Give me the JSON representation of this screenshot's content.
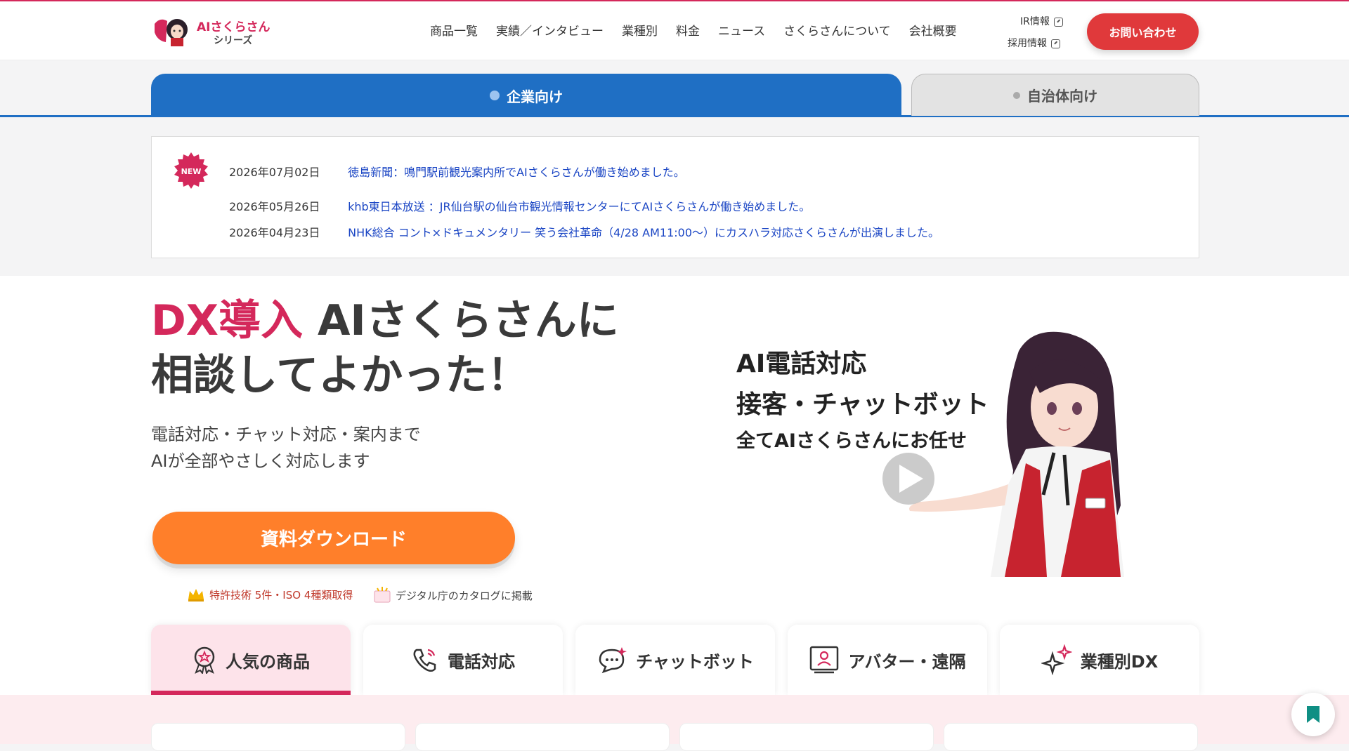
{
  "header": {
    "logo_title": "AIさくらさん",
    "logo_sub": "シリーズ",
    "nav": [
      "商品一覧",
      "実績／インタビュー",
      "業種別",
      "料金",
      "ニュース",
      "さくらさんについて",
      "会社概要"
    ],
    "ir_label": "IR情報",
    "recruit_label": "採用情報",
    "contact_label": "お問い合わせ"
  },
  "audience_tabs": {
    "corporate": "企業向け",
    "government": "自治体向け"
  },
  "news": {
    "badge": "NEW",
    "items": [
      {
        "date": "2026年07月02日",
        "headline": "徳島新聞：鳴門駅前観光案内所でAIさくらさんが働き始めました。"
      },
      {
        "date": "2026年05月26日",
        "headline": "khb東日本放送 ：JR仙台駅の仙台市観光情報センターにてAIさくらさんが働き始めました。"
      },
      {
        "date": "2026年04月23日",
        "headline": "NHK総合 コント×ドキュメンタリー 笑う会社革命（4/28 AM11:00〜）にカスハラ対応さくらさんが出演しました。"
      }
    ]
  },
  "hero": {
    "title_accent": "DX導入",
    "title_line1_rest": " AIさくらさんに",
    "title_line2": "相談してよかった！",
    "sub_line1": "電話対応・チャット対応・案内まで",
    "sub_line2": "AIが全部やさしく対応します",
    "download_label": "資料ダウンロード",
    "cert_patent": "特許技術 5件・ISO 4種類取得",
    "cert_catalog": "デジタル庁のカタログに掲載",
    "right_line1": "AI電話対応",
    "right_line2": "接客・チャットボット",
    "right_line3": "全てAIさくらさんにお任せ"
  },
  "categories": [
    "人気の商品",
    "電話対応",
    "チャットボット",
    "アバター・遠隔",
    "業種別DX"
  ],
  "colors": {
    "brand_pink": "#d4285b",
    "corporate_blue": "#1f6fc4",
    "download_orange": "#ff7f2a",
    "contact_red": "#e0393b",
    "news_link": "#1a45c4"
  }
}
